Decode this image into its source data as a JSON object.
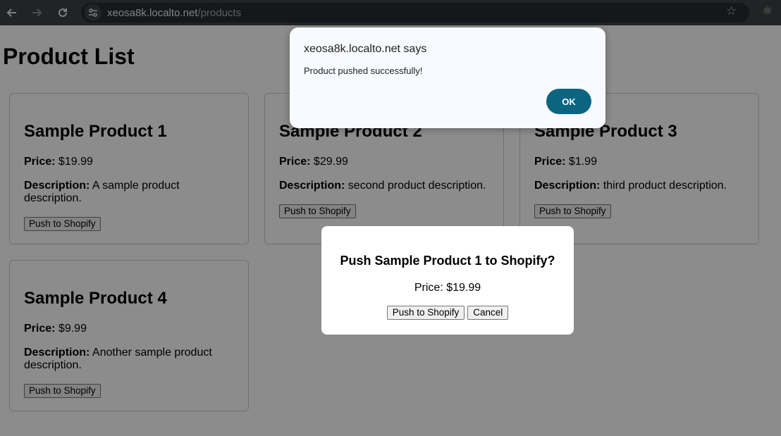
{
  "browser": {
    "url_host": "xeosa8k.localto.net",
    "url_path": "/products"
  },
  "page": {
    "title": "Product List",
    "price_label": "Price:",
    "description_label": "Description:",
    "products": [
      {
        "name": "Sample Product 1",
        "price": "$19.99",
        "description": "A sample product description.",
        "button": "Push to Shopify"
      },
      {
        "name": "Sample Product 2",
        "price": "$29.99",
        "description": "second product description.",
        "button": "Push to Shopify"
      },
      {
        "name": "Sample Product 3",
        "price": "$1.99",
        "description": "third product description.",
        "button": "Push to Shopify"
      },
      {
        "name": "Sample Product 4",
        "price": "$9.99",
        "description": "Another sample product description.",
        "button": "Push to Shopify"
      }
    ]
  },
  "modal": {
    "title": "Push Sample Product 1 to Shopify?",
    "price": "Price: $19.99",
    "confirm_label": "Push to Shopify",
    "cancel_label": "Cancel"
  },
  "alert": {
    "title": "xeosa8k.localto.net says",
    "message": "Product pushed successfully!",
    "ok_label": "OK"
  },
  "colors": {
    "toolbar": "#3c4043",
    "alert_button": "#0b6581",
    "alert_bg": "#f8faff"
  }
}
